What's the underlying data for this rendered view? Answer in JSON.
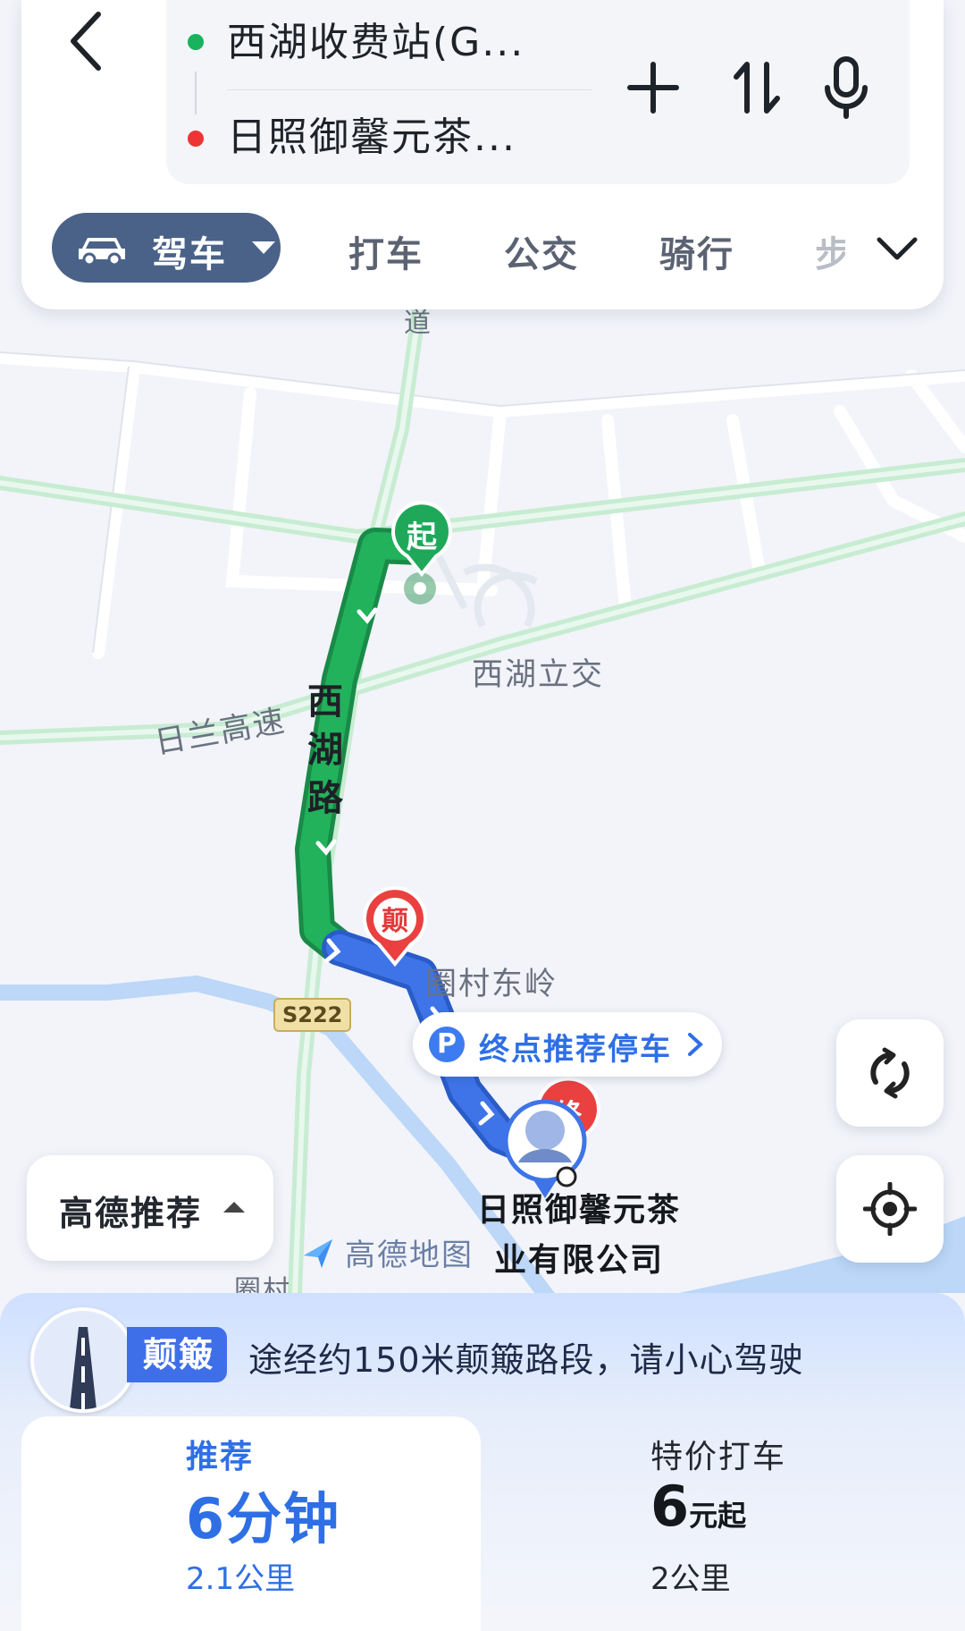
{
  "route": {
    "start": "西湖收费站(G...",
    "end": "日照御馨元茶..."
  },
  "modes": {
    "active": "驾车",
    "items": [
      "打车",
      "公交",
      "骑行",
      "步"
    ]
  },
  "map": {
    "labels": {
      "north_road": "道",
      "interchange": "西湖立交",
      "expressway": "日兰高速",
      "road_name": "西湖路",
      "village": "圈村东岭",
      "bottom_village": "圈村"
    },
    "road_badge": "S222",
    "start_marker": "起",
    "bump_marker": "颠",
    "end_marker": "终",
    "parking_prompt": "终点推荐停车",
    "parking_icon": "P",
    "destination_name_line1": "日照御馨元茶",
    "destination_name_line2": "业有限公司",
    "watermark": "高德地图",
    "colors": {
      "route_green": "#1fa85a",
      "route_blue": "#3e74e8"
    }
  },
  "controls": {
    "recommend_label": "高德推荐"
  },
  "notice": {
    "tag": "颠簸",
    "text": "途经约150米颠簸路段，请小心驾驶"
  },
  "options": {
    "recommended": {
      "tag": "推荐",
      "time": "6分钟",
      "distance": "2.1公里"
    },
    "taxi": {
      "tag": "特价打车",
      "price": "6",
      "price_suffix": "元起",
      "distance": "2公里"
    }
  }
}
